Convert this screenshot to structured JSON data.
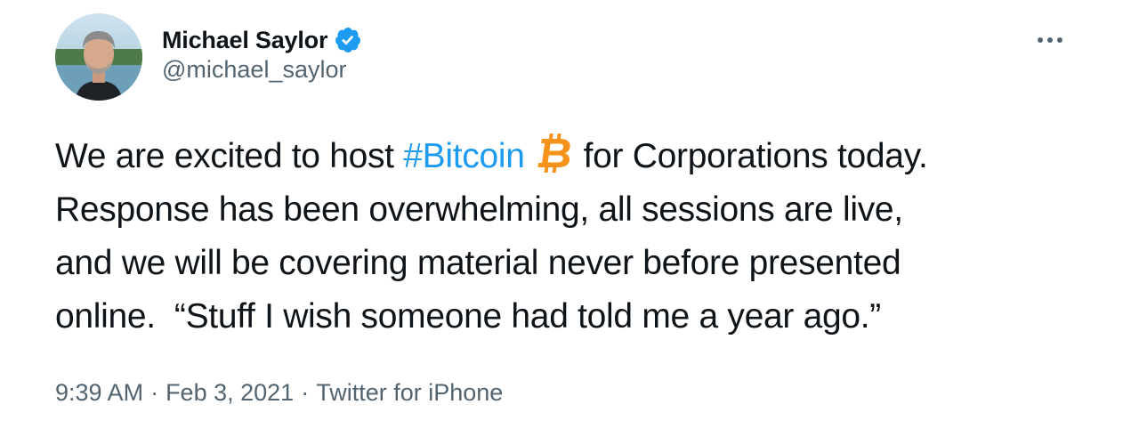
{
  "user": {
    "display_name": "Michael Saylor",
    "handle": "@michael_saylor",
    "verified": true,
    "avatar_icon": "profile-photo"
  },
  "tweet": {
    "line1_before": "We are excited to host ",
    "hashtag": "#Bitcoin",
    "emoji_icon": "bitcoin-icon",
    "line1_after": "for Corporations today.",
    "line2": "Response has been overwhelming, all sessions are live,",
    "line3": "and we will be covering material never before presented",
    "line4": "online.  “Stuff I wish someone had told me a year ago.”"
  },
  "meta": {
    "time": "9:39 AM",
    "separator": "·",
    "date": "Feb 3, 2021",
    "source": "Twitter for iPhone"
  },
  "colors": {
    "text": "#0f1419",
    "secondary": "#536471",
    "accent": "#1d9bf0",
    "bitcoin": "#f7931a"
  }
}
